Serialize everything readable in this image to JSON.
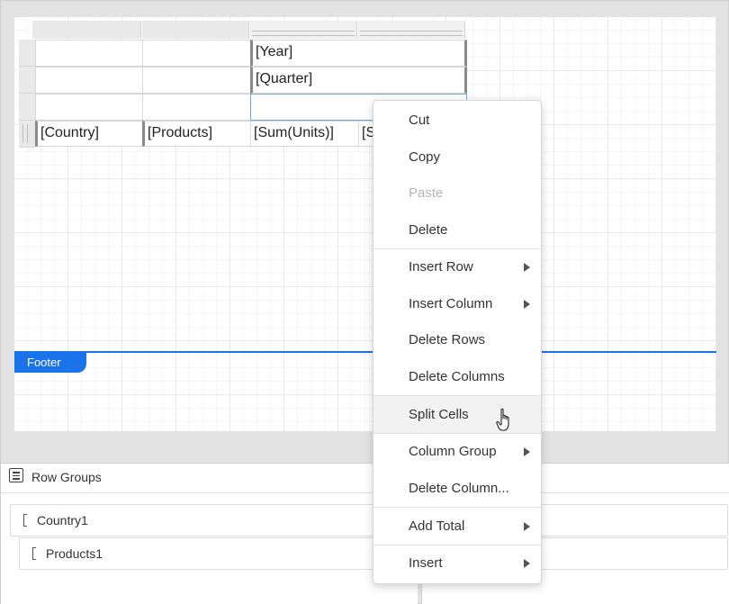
{
  "tablix": {
    "year_cell": "[Year]",
    "quarter_cell": "[Quarter]",
    "empty_cell": "",
    "country_cell": "[Country]",
    "products_cell": "[Products]",
    "sum_units_cell": "[Sum(Units)]",
    "partial_cell": "[S"
  },
  "footer": {
    "label": "Footer"
  },
  "row_groups": {
    "title": "Row Groups",
    "icon": "list-icon",
    "items": [
      {
        "label": "Country1"
      },
      {
        "label": "Products1"
      }
    ]
  },
  "context_menu": {
    "items": [
      {
        "label": "Cut",
        "enabled": true,
        "submenu": false
      },
      {
        "label": "Copy",
        "enabled": true,
        "submenu": false
      },
      {
        "label": "Paste",
        "enabled": false,
        "submenu": false
      },
      {
        "label": "Delete",
        "enabled": true,
        "submenu": false
      },
      {
        "label": "Insert Row",
        "enabled": true,
        "submenu": true
      },
      {
        "label": "Insert Column",
        "enabled": true,
        "submenu": true
      },
      {
        "label": "Delete Rows",
        "enabled": true,
        "submenu": false
      },
      {
        "label": "Delete Columns",
        "enabled": true,
        "submenu": false
      },
      {
        "label": "Split Cells",
        "enabled": true,
        "submenu": false,
        "hovered": true
      },
      {
        "label": "Column Group",
        "enabled": true,
        "submenu": true
      },
      {
        "label": "Delete Column...",
        "enabled": true,
        "submenu": false
      },
      {
        "label": "Add Total",
        "enabled": true,
        "submenu": true
      },
      {
        "label": "Insert",
        "enabled": true,
        "submenu": true
      }
    ]
  },
  "colors": {
    "accent": "#1a73e8",
    "hover_bg": "#f2f2f2",
    "disabled_text": "#b5b5b5"
  },
  "cursor": "hand-pointer-icon"
}
